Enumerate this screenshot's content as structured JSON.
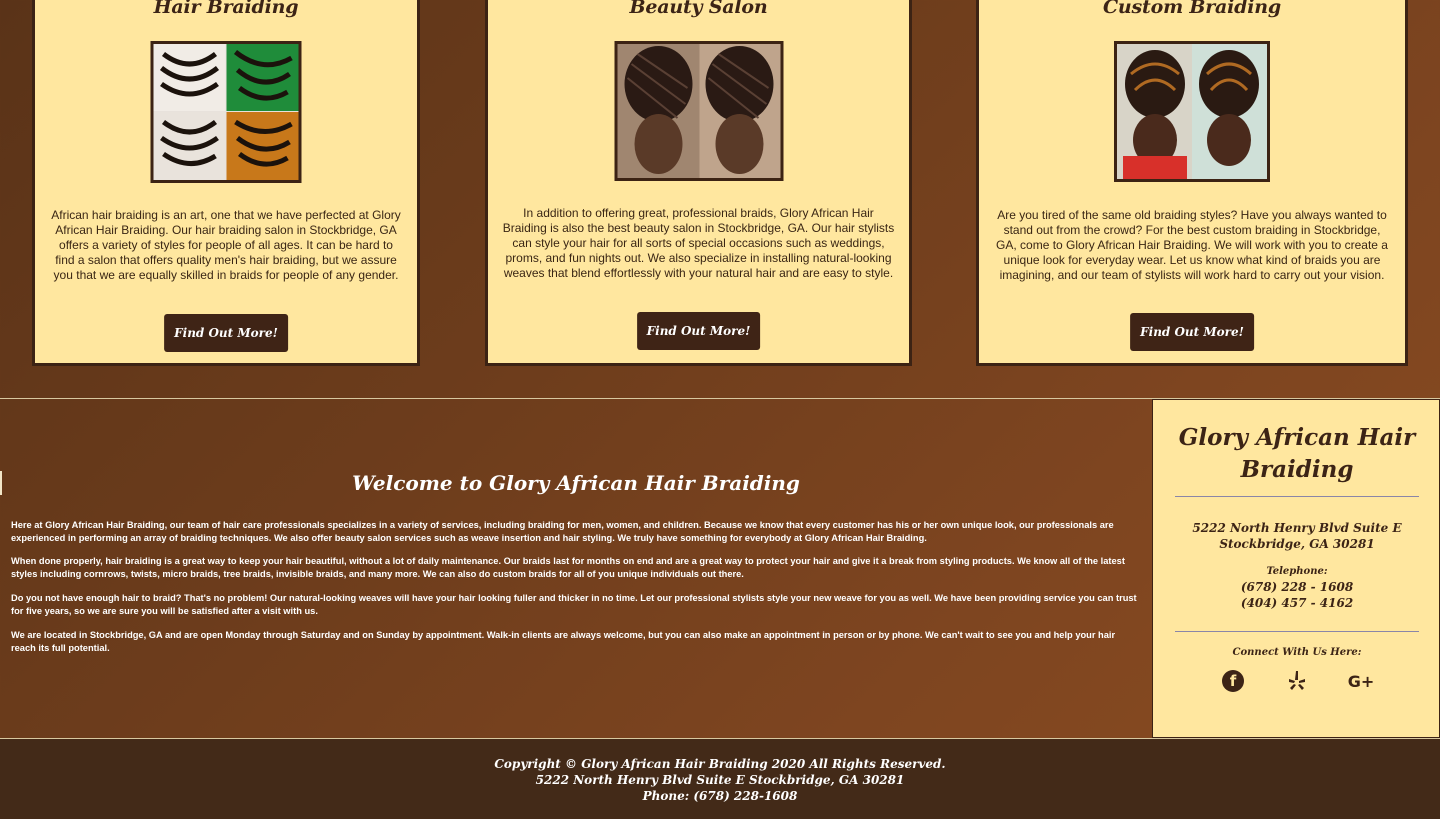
{
  "services": [
    {
      "title": "Hair Braiding",
      "body": "African hair braiding is an art, one that we have perfected at Glory African Hair Braiding. Our hair braiding salon in Stockbridge, GA offers a variety of styles for people of all ages. It can be hard to find a salon that offers quality men's hair braiding, but we assure you that we are equally skilled in braids for people of any gender.",
      "button": "Find Out More!"
    },
    {
      "title": "Beauty Salon",
      "body": "In addition to offering great, professional braids, Glory African Hair Braiding is also the best beauty salon in Stockbridge, GA. Our hair stylists can style your hair for all sorts of special occasions such as weddings, proms, and fun nights out. We also specialize in installing natural-looking weaves that blend effortlessly with your natural hair and are easy to style.",
      "button": "Find Out More!"
    },
    {
      "title": "Custom Braiding",
      "body": "Are you tired of the same old braiding styles? Have you always wanted to stand out from the crowd? For the best custom braiding in Stockbridge, GA, come to Glory African Hair Braiding. We will work with you to create a unique look for everyday wear. Let us know what kind of braids you are imagining, and our team of stylists will work hard to carry out your vision.",
      "button": "Find Out More!"
    }
  ],
  "welcome": {
    "title": "Welcome to Glory African Hair Braiding",
    "paragraphs": [
      "Here at Glory African Hair Braiding, our team of hair care professionals specializes in a variety of services, including braiding for men, women, and children. Because we know that every customer has his or her own unique look, our professionals are experienced in performing an array of braiding techniques. We also offer beauty salon services such as weave insertion and hair styling. We truly have something for everybody at Glory African Hair Braiding.",
      "When done properly, hair braiding is a great way to keep your hair beautiful, without a lot of daily maintenance. Our braids last for months on end and are a great way to protect your hair and give it a break from styling products. We know all of the latest styles including cornrows, twists, micro braids, tree braids, invisible braids, and many more. We can also do custom braids for all of you unique individuals out there.",
      "Do you not have enough hair to braid? That's no problem! Our natural-looking weaves will have your hair looking fuller and thicker in no time. Let our professional stylists style your new weave for you as well. We have been providing service you can trust for five years, so we are sure you will be satisfied after a visit with us.",
      "We are located in Stockbridge, GA and are open Monday through Saturday and on Sunday by appointment. Walk-in clients are always welcome, but you can also make an appointment in person or by phone. We can't wait to see you and help your hair reach its full potential."
    ]
  },
  "contact": {
    "business_name": "Glory African Hair Braiding",
    "address_line1": "5222 North Henry Blvd Suite E",
    "address_line2": "Stockbridge, GA 30281",
    "telephone_label": "Telephone:",
    "phone1": "(678) 228 - 1608",
    "phone2": "(404) 457 - 4162",
    "connect_label": "Connect With Us Here:",
    "social_icons": [
      "facebook-icon",
      "yelp-icon",
      "google-plus-icon"
    ],
    "google_plus_text": "G+"
  },
  "footer": {
    "copyright": "Copyright © Glory African Hair Braiding 2020 All Rights Reserved.",
    "address": "5222 North Henry Blvd Suite E Stockbridge, GA 30281",
    "phone": "Phone: (678) 228-1608"
  },
  "colors": {
    "card_bg": "#ffe79f",
    "dark_brown": "#3c2314",
    "button_bg": "#3f2416",
    "footer_bg": "#432a18"
  }
}
